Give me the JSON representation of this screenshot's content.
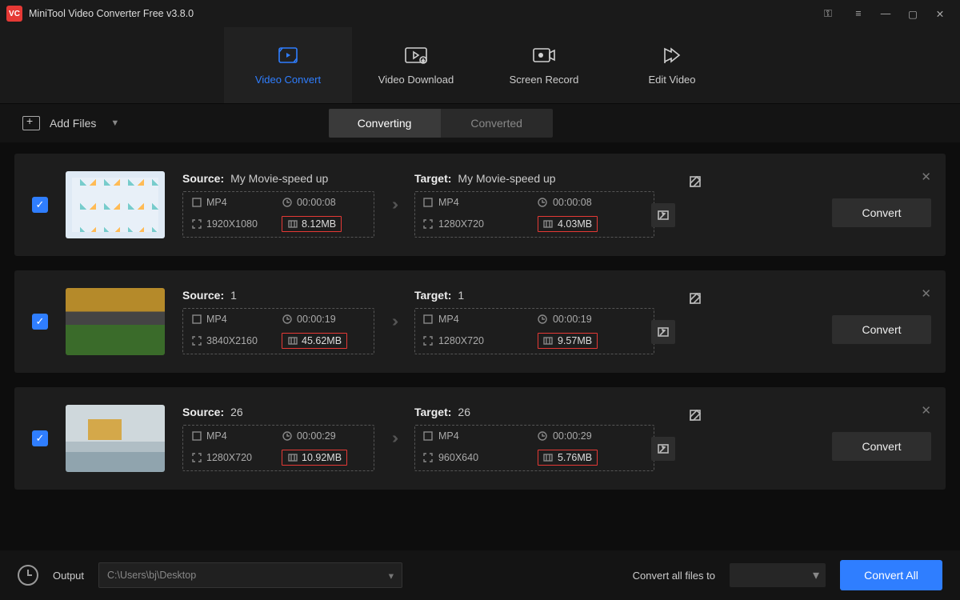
{
  "title": "MiniTool Video Converter Free v3.8.0",
  "toptabs": {
    "convert": "Video Convert",
    "download": "Video Download",
    "record": "Screen Record",
    "edit": "Edit Video"
  },
  "toolbar": {
    "add_files": "Add Files",
    "seg_converting": "Converting",
    "seg_converted": "Converted"
  },
  "labels": {
    "source": "Source:",
    "target": "Target:",
    "convert": "Convert"
  },
  "items": [
    {
      "source_name": "My Movie-speed up",
      "target_name": "My Movie-speed up",
      "src_format": "MP4",
      "src_dur": "00:00:08",
      "src_res": "1920X1080",
      "src_size": "8.12MB",
      "tgt_format": "MP4",
      "tgt_dur": "00:00:08",
      "tgt_res": "1280X720",
      "tgt_size": "4.03MB"
    },
    {
      "source_name": "1",
      "target_name": "1",
      "src_format": "MP4",
      "src_dur": "00:00:19",
      "src_res": "3840X2160",
      "src_size": "45.62MB",
      "tgt_format": "MP4",
      "tgt_dur": "00:00:19",
      "tgt_res": "1280X720",
      "tgt_size": "9.57MB"
    },
    {
      "source_name": "26",
      "target_name": "26",
      "src_format": "MP4",
      "src_dur": "00:00:29",
      "src_res": "1280X720",
      "src_size": "10.92MB",
      "tgt_format": "MP4",
      "tgt_dur": "00:00:29",
      "tgt_res": "960X640",
      "tgt_size": "5.76MB"
    }
  ],
  "bottom": {
    "output_label": "Output",
    "output_path": "C:\\Users\\bj\\Desktop",
    "all_to_label": "Convert all files to",
    "convert_all": "Convert All"
  }
}
